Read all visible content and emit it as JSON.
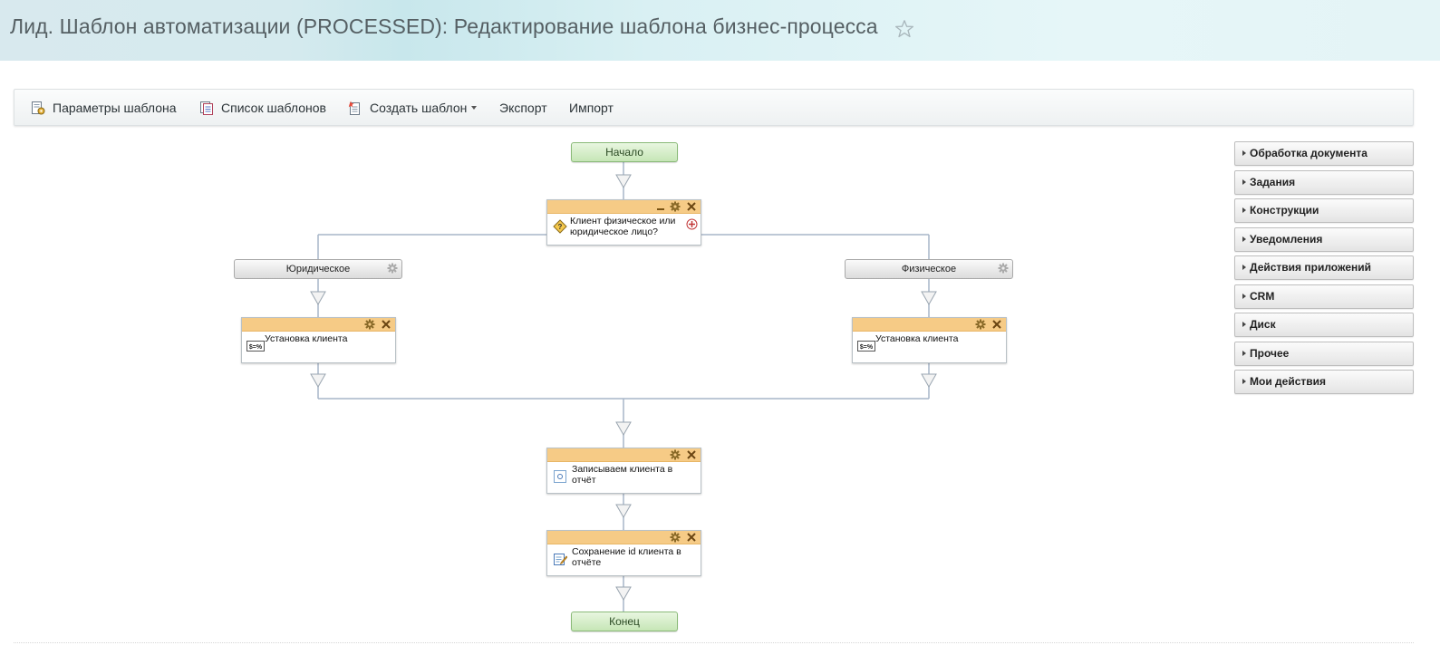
{
  "header": {
    "title": "Лид. Шаблон автоматизации (PROCESSED): Редактирование шаблона бизнес-процесса",
    "favorite_icon": "star-outline-icon"
  },
  "toolbar": {
    "template_params": "Параметры шаблона",
    "template_list": "Список шаблонов",
    "create_template": "Создать шаблон",
    "export": "Экспорт",
    "import": "Импорт"
  },
  "workflow": {
    "start": "Начало",
    "condition": "Клиент физическое или юридическое лицо?",
    "branch_left": "Юридическое",
    "branch_right": "Физическое",
    "left_activity": "Установка клиента",
    "right_activity": "Установка клиента",
    "report_activity": "Записываем клиента в отчёт",
    "save_activity": "Сохранение id клиента в отчёте",
    "end": "Конец"
  },
  "activity_panel": {
    "items": [
      {
        "label": "Обработка документа"
      },
      {
        "label": "Задания"
      },
      {
        "label": "Конструкции"
      },
      {
        "label": "Уведомления"
      },
      {
        "label": "Действия приложений"
      },
      {
        "label": "CRM"
      },
      {
        "label": "Диск"
      },
      {
        "label": "Прочее"
      },
      {
        "label": "Мои действия"
      }
    ]
  },
  "colors": {
    "activity_header": "#f6cb86",
    "start_end_fill": "#c6e6b6",
    "connector": "#a7b6c9"
  }
}
